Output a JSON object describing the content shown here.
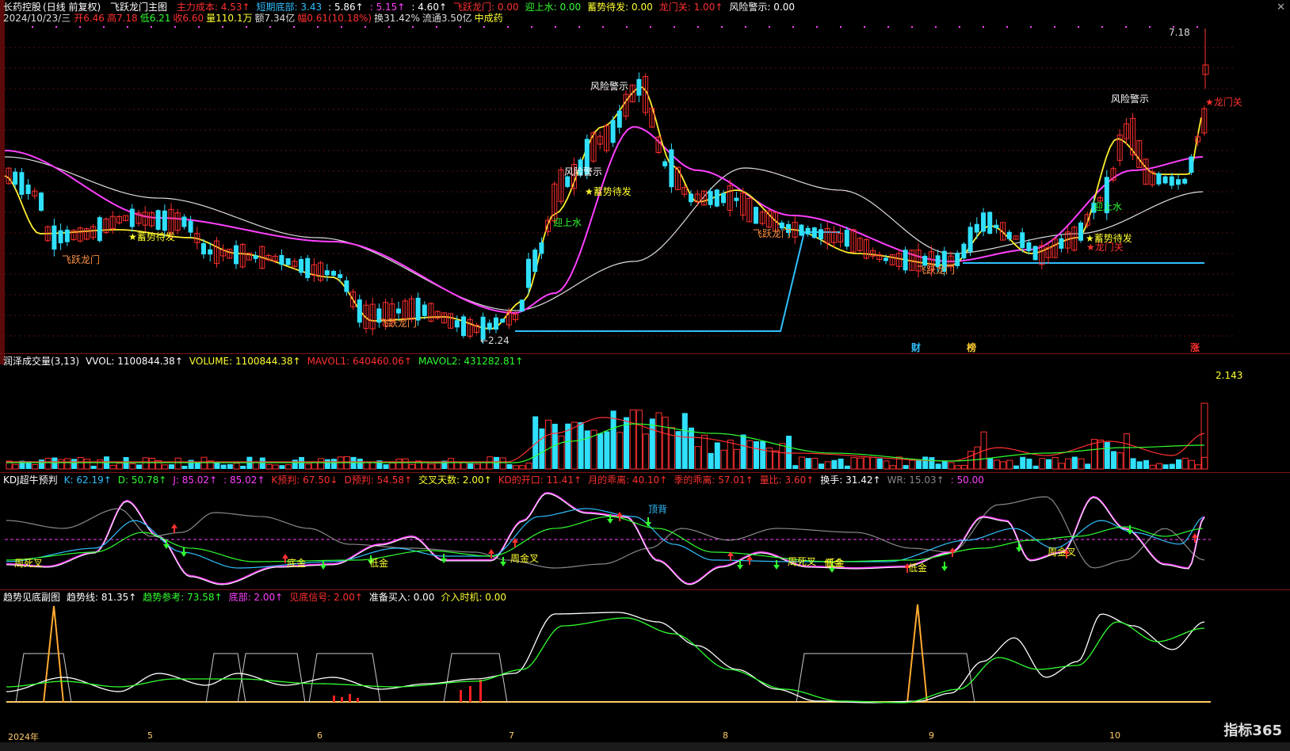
{
  "window": {
    "stock_name": "长药控股",
    "period": "(日线 前复权)",
    "close_icon": "close-icon"
  },
  "info_line": {
    "date": "2024/10/23/三",
    "open": "开6.46",
    "high": "高7.18",
    "low": "低6.21",
    "close": "收6.60",
    "volume": "量110.1万",
    "amount": "额7.34亿",
    "change": "幅0.61(10.18%)",
    "turnover": "换31.42%",
    "float": "流通3.50亿",
    "sector": "中成药"
  },
  "main_header": {
    "title": "飞跃龙门主图",
    "items": [
      {
        "text": "主力成本: 4.53↑",
        "color": "#ff3030"
      },
      {
        "text": "短期底部: 3.43",
        "color": "#30c0ff"
      },
      {
        "text": ": 5.86↑",
        "color": "#ffffff"
      },
      {
        "text": ": 5.15↑",
        "color": "#ff40ff"
      },
      {
        "text": ": 4.60↑",
        "color": "#ffffff"
      },
      {
        "text": "飞跃龙门: 0.00",
        "color": "#ff3030"
      },
      {
        "text": "迎上水: 0.00",
        "color": "#30ff30"
      },
      {
        "text": "蓄势待发: 0.00",
        "color": "#ffff30"
      },
      {
        "text": "龙门关: 1.00↑",
        "color": "#ff3030"
      },
      {
        "text": "风险警示: 0.00",
        "color": "#ffffff"
      }
    ]
  },
  "main_annotations": [
    {
      "text": "飞跃龙门",
      "color": "#ff9040"
    },
    {
      "text": "★蓄势待发",
      "color": "#ffff30"
    },
    {
      "text": "飞跃龙门",
      "color": "#ff9040"
    },
    {
      "text": "←2.24",
      "color": "#dddddd"
    },
    {
      "text": "风险警示",
      "color": "#ffffff"
    },
    {
      "text": "风险警示",
      "color": "#ffffff"
    },
    {
      "text": "★蓄势待发",
      "color": "#ffff30"
    },
    {
      "text": "迎上水",
      "color": "#30ff30"
    },
    {
      "text": "飞跃龙门",
      "color": "#ff9040"
    },
    {
      "text": "飞跃龙门",
      "color": "#ff9040"
    },
    {
      "text": "风险警示",
      "color": "#ffffff"
    },
    {
      "text": "迎上水",
      "color": "#30ff30"
    },
    {
      "text": "★蓄势待发",
      "color": "#ffff30"
    },
    {
      "text": "★龙门关",
      "color": "#ff3030"
    },
    {
      "text": "★龙门关",
      "color": "#ff3030"
    },
    {
      "text": "7.18",
      "color": "#dddddd"
    }
  ],
  "event_markers": [
    {
      "text": "财",
      "color": "#30c0ff"
    },
    {
      "text": "榜",
      "color": "#ffcc30"
    },
    {
      "text": "涨",
      "color": "#ff3030"
    }
  ],
  "volume_header": {
    "title": "润泽成交量(3,13)",
    "items": [
      {
        "text": "VVOL: 1100844.38↑",
        "color": "#ffffff"
      },
      {
        "text": "VOLUME: 1100844.38↑",
        "color": "#ffff30"
      },
      {
        "text": "MAVOL1: 640460.06↑",
        "color": "#ff3030"
      },
      {
        "text": "MAVOL2: 431282.81↑",
        "color": "#30ff30"
      }
    ],
    "max_label": "2.143"
  },
  "kdj_header": {
    "title": "KDJ超牛预判",
    "items": [
      {
        "text": "K: 62.19↑",
        "color": "#30c0ff"
      },
      {
        "text": "D: 50.78↑",
        "color": "#30ff30"
      },
      {
        "text": "J: 85.02↑",
        "color": "#ff40ff"
      },
      {
        "text": ": 85.02↑",
        "color": "#ff40ff"
      },
      {
        "text": "K预判: 67.50↓",
        "color": "#ff3030"
      },
      {
        "text": "D预判: 54.58↑",
        "color": "#ff3030"
      },
      {
        "text": "交叉天数: 2.00↑",
        "color": "#ffff30"
      },
      {
        "text": "KD的开口: 11.41↑",
        "color": "#ff3030"
      },
      {
        "text": "月的乖离: 40.10↑",
        "color": "#ff3030"
      },
      {
        "text": "季的乖离: 57.01↑",
        "color": "#ff3030"
      },
      {
        "text": "量比: 3.60↑",
        "color": "#ff3030"
      },
      {
        "text": "换手: 31.42↑",
        "color": "#ffffff"
      },
      {
        "text": "WR: 15.03↑",
        "color": "#888888"
      },
      {
        "text": ": 50.00",
        "color": "#ff40ff"
      }
    ]
  },
  "kdj_annotations": [
    {
      "text": "周死叉",
      "color": "#ffff30"
    },
    {
      "text": "底金",
      "color": "#ffff30"
    },
    {
      "text": "低金",
      "color": "#ffff30"
    },
    {
      "text": "低金",
      "color": "#ffff30"
    },
    {
      "text": "周金叉",
      "color": "#ffff30"
    },
    {
      "text": "顶背",
      "color": "#30c0ff"
    },
    {
      "text": "周死叉",
      "color": "#ffff30"
    },
    {
      "text": "低金",
      "color": "#ffff30"
    },
    {
      "text": "低金",
      "color": "#ffff30"
    },
    {
      "text": "周金叉",
      "color": "#ffff30"
    }
  ],
  "trend_header": {
    "title": "趋势见底副图",
    "items": [
      {
        "text": "趋势线: 81.35↑",
        "color": "#ffffff"
      },
      {
        "text": "趋势参考: 73.58↑",
        "color": "#30ff30"
      },
      {
        "text": "底部: 2.00↑",
        "color": "#ff40ff"
      },
      {
        "text": "见底信号: 2.00↑",
        "color": "#ff3030"
      },
      {
        "text": "准备买入: 0.00",
        "color": "#ffffff"
      },
      {
        "text": "介入时机: 0.00",
        "color": "#ffff30"
      }
    ]
  },
  "x_axis": {
    "labels": [
      "2024年",
      "5",
      "6",
      "7",
      "8",
      "9",
      "10"
    ]
  },
  "logo": "指标365"
}
